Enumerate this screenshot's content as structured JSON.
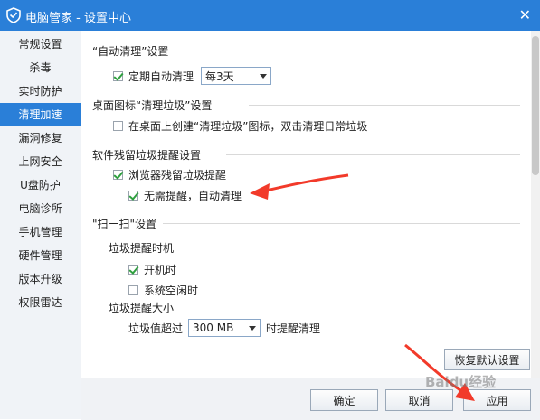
{
  "window": {
    "title": "电脑管家 - 设置中心",
    "close_label": "✕"
  },
  "sidebar": {
    "items": [
      {
        "label": "常规设置"
      },
      {
        "label": "杀毒"
      },
      {
        "label": "实时防护"
      },
      {
        "label": "清理加速",
        "active": true
      },
      {
        "label": "漏洞修复"
      },
      {
        "label": "上网安全"
      },
      {
        "label": "U盘防护"
      },
      {
        "label": "电脑诊所"
      },
      {
        "label": "手机管理"
      },
      {
        "label": "硬件管理"
      },
      {
        "label": "版本升级"
      },
      {
        "label": "权限雷达"
      }
    ]
  },
  "auto_clean": {
    "title": "“自动清理”设置",
    "option_label": "定期自动清理",
    "checked": true,
    "interval_value": "每3天"
  },
  "desktop_icon": {
    "title": "桌面图标“清理垃圾”设置",
    "option_label": "在桌面上创建“清理垃圾”图标，双击清理日常垃圾",
    "checked": false
  },
  "residual_reminder": {
    "title": "软件残留垃圾提醒设置",
    "browser_label": "浏览器残留垃圾提醒",
    "browser_checked": true,
    "no_remind_label": "无需提醒，自动清理",
    "no_remind_checked": true
  },
  "scan": {
    "title": "\"扫一扫\"设置",
    "timing_title": "垃圾提醒时机",
    "boot_label": "开机时",
    "boot_checked": true,
    "idle_label": "系统空闲时",
    "idle_checked": false,
    "size_title": "垃圾提醒大小",
    "size_prefix": "垃圾值超过",
    "size_value": "300 MB",
    "size_suffix": "时提醒清理"
  },
  "buttons": {
    "restore_default": "恢复默认设置",
    "ok": "确定",
    "cancel": "取消",
    "apply": "应用"
  },
  "watermark": {
    "text": "Baidu经验"
  },
  "colors": {
    "accent": "#2a7fd8",
    "arrow": "#f23a2a",
    "check": "#2fa03f"
  }
}
